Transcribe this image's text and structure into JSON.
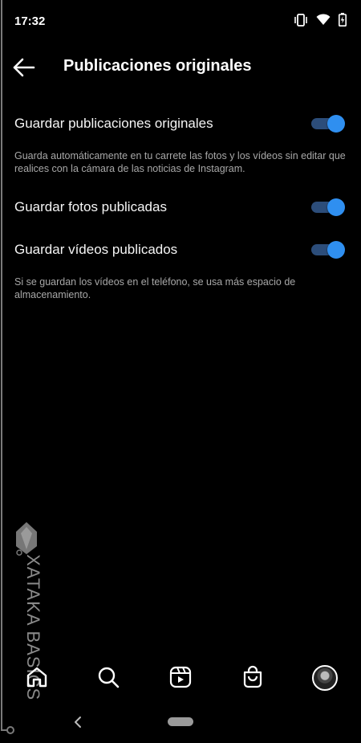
{
  "status_bar": {
    "time": "17:32"
  },
  "header": {
    "title": "Publicaciones originales"
  },
  "settings": [
    {
      "label": "Guardar publicaciones originales",
      "enabled": true
    },
    {
      "label": "Guardar fotos publicadas",
      "enabled": true
    },
    {
      "label": "Guardar vídeos publicados",
      "enabled": true
    }
  ],
  "descriptions": {
    "originals": "Guarda automáticamente en tu carrete las fotos y los vídeos sin editar que realices con la cámara de las noticias de Instagram.",
    "videos": "Si se guardan los vídeos en el teléfono, se usa más espacio de almacenamiento."
  },
  "watermark": {
    "text": "XATAKA BASICS"
  },
  "bottom_nav": {
    "items": [
      "home-icon",
      "search-icon",
      "reels-icon",
      "shop-icon",
      "profile-avatar"
    ]
  },
  "colors": {
    "toggle_on": "#2f8ff0",
    "toggle_track": "#2c4d7a",
    "background": "#000000"
  }
}
